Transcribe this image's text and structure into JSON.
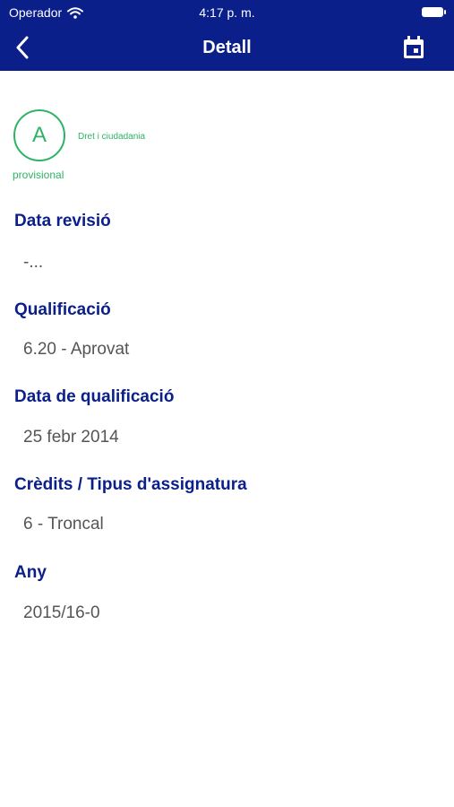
{
  "status_bar": {
    "carrier": "Operador",
    "time": "4:17 p. m."
  },
  "nav": {
    "title": "Detall",
    "back_icon": "chevron-left-icon",
    "calendar_icon": "calendar-icon"
  },
  "summary": {
    "grade_letter": "A",
    "subject": "Dret i ciudadania",
    "status": "provisional"
  },
  "fields": [
    {
      "label": "Data revisió",
      "value": "-..."
    },
    {
      "label": "Qualificació",
      "value": "6.20 - Aprovat"
    },
    {
      "label": "Data de qualificació",
      "value": "25 febr 2014"
    },
    {
      "label": "Crèdits / Tipus d'assignatura",
      "value": "6 - Troncal"
    },
    {
      "label": "Any",
      "value": "2015/16-0"
    }
  ],
  "colors": {
    "primary": "#0a1f8a",
    "accent": "#2db365",
    "value_text": "#555555"
  }
}
